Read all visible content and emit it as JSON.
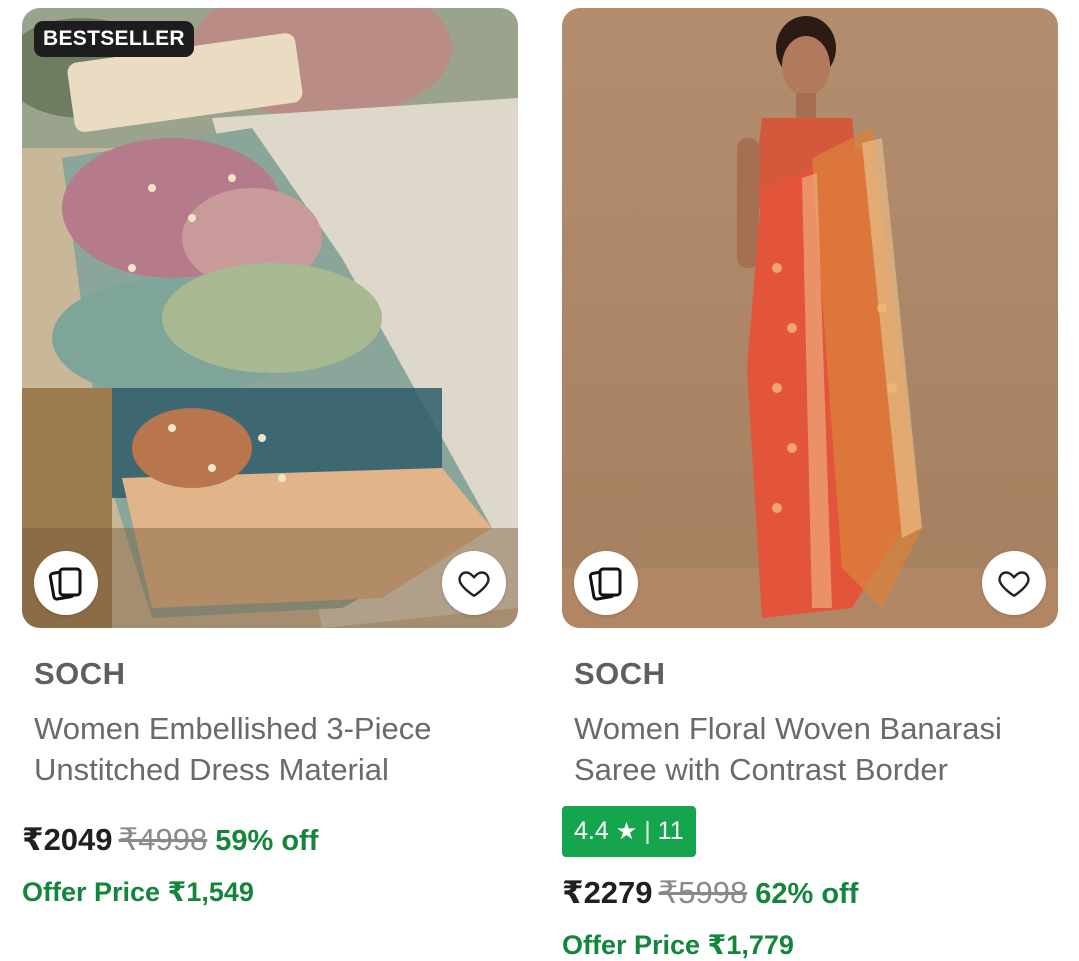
{
  "colors": {
    "offer_green": "#14863c",
    "rating_bg": "#14a54d",
    "badge_bg": "#1d1d1d"
  },
  "products": [
    {
      "badge": "BESTSELLER",
      "brand": "SOCH",
      "title": "Women Embellished 3-Piece Unstitched Dress Material",
      "price": "₹2049",
      "mrp": "₹4998",
      "discount": "59% off",
      "offer_price": "Offer Price ₹1,549",
      "icons": {
        "similar": "similar-products-icon",
        "wishlist": "heart-icon"
      }
    },
    {
      "brand": "SOCH",
      "title": "Women Floral Woven Banarasi Saree with Contrast Border",
      "rating": "4.4",
      "rating_star": "★",
      "rating_separator": "|",
      "rating_count": "11",
      "price": "₹2279",
      "mrp": "₹5998",
      "discount": "62% off",
      "offer_price": "Offer Price ₹1,779",
      "icons": {
        "similar": "similar-products-icon",
        "wishlist": "heart-icon"
      }
    }
  ]
}
